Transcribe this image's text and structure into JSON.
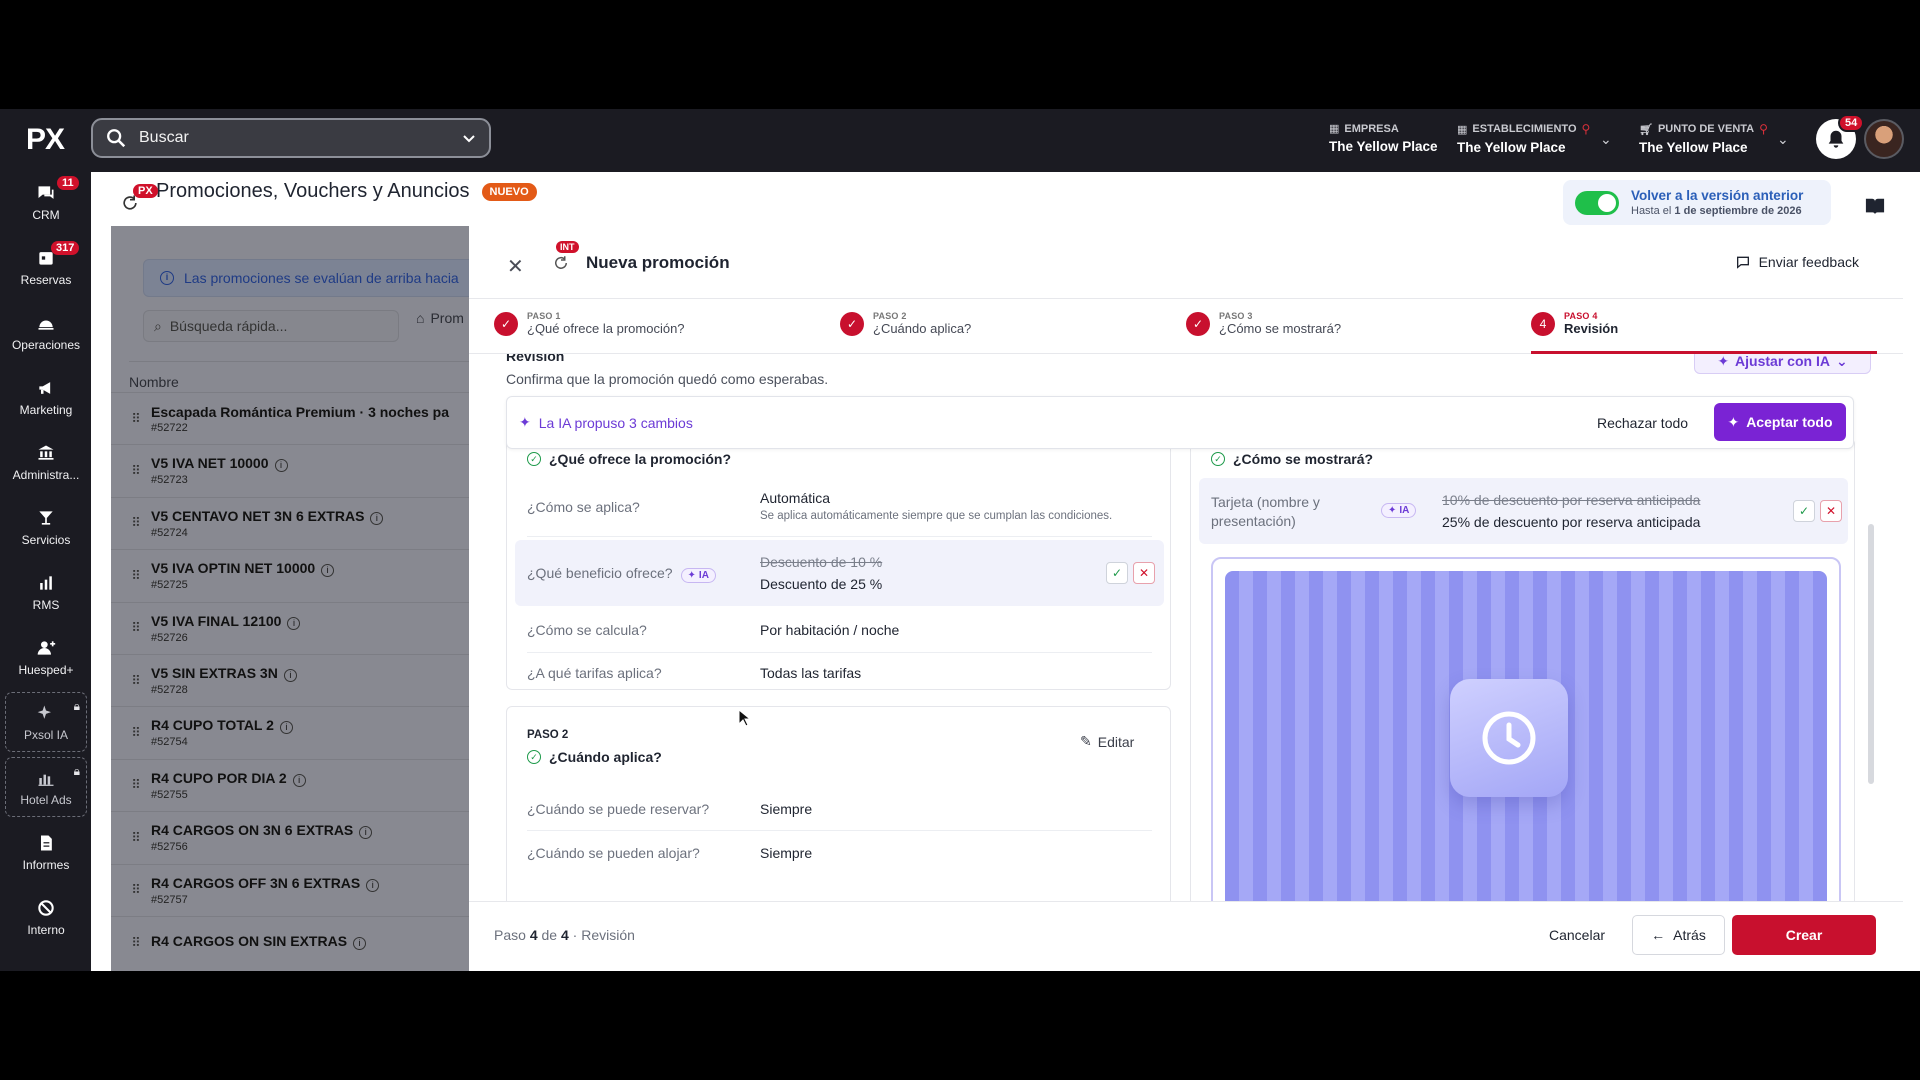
{
  "app": {
    "logo": "PX"
  },
  "search": {
    "placeholder": "Buscar"
  },
  "header": {
    "empresa": {
      "caption": "EMPRESA",
      "value": "The Yellow Place"
    },
    "establecimiento": {
      "caption": "ESTABLECIMIENTO",
      "value": "The Yellow Place"
    },
    "punto_venta": {
      "caption": "PUNTO DE VENTA",
      "value": "The Yellow Place"
    },
    "notifications": "54"
  },
  "sidebar": {
    "items": [
      {
        "label": "CRM",
        "badge": "11",
        "icon": "chat-icon"
      },
      {
        "label": "Reservas",
        "badge": "317",
        "icon": "calendar-icon"
      },
      {
        "label": "Operaciones",
        "icon": "bell-service-icon"
      },
      {
        "label": "Marketing",
        "icon": "megaphone-icon"
      },
      {
        "label": "Administra...",
        "icon": "bank-icon"
      },
      {
        "label": "Servicios",
        "icon": "cocktail-icon"
      },
      {
        "label": "RMS",
        "icon": "chart-icon"
      },
      {
        "label": "Huesped+",
        "icon": "guest-icon"
      },
      {
        "label": "Pxsol IA",
        "icon": "sparkle-icon",
        "locked": true
      },
      {
        "label": "Hotel Ads",
        "icon": "bar-chart-icon",
        "locked": true
      },
      {
        "label": "Informes",
        "icon": "document-icon"
      },
      {
        "label": "Interno",
        "icon": "block-icon"
      }
    ]
  },
  "page": {
    "title": "Promociones, Vouchers y Anuncios",
    "badge": "NUEVO",
    "px_badge": "PX",
    "toggle_title": "Volver a la versión anterior",
    "toggle_prefix": "Hasta el ",
    "toggle_date": "1 de septiembre de 2026"
  },
  "list": {
    "banner": "Las promociones se evalúan de arriba hacia",
    "quick_search": "Búsqueda rápida...",
    "filter": "Prom",
    "column": "Nombre",
    "rows": [
      {
        "name": "Escapada Romántica Premium · 3 noches pa",
        "id": "#52722"
      },
      {
        "name": "V5 IVA NET 10000",
        "id": "#52723"
      },
      {
        "name": "V5 CENTAVO NET 3N 6 EXTRAS",
        "id": "#52724"
      },
      {
        "name": "V5 IVA OPTIN NET 10000",
        "id": "#52725"
      },
      {
        "name": "V5 IVA FINAL 12100",
        "id": "#52726"
      },
      {
        "name": "V5 SIN EXTRAS 3N",
        "id": "#52728"
      },
      {
        "name": "R4 CUPO TOTAL 2",
        "id": "#52754"
      },
      {
        "name": "R4 CUPO POR DIA 2",
        "id": "#52755"
      },
      {
        "name": "R4 CARGOS ON 3N 6 EXTRAS",
        "id": "#52756"
      },
      {
        "name": "R4 CARGOS OFF 3N 6 EXTRAS",
        "id": "#52757"
      },
      {
        "name": "R4 CARGOS ON SIN EXTRAS",
        "id": ""
      }
    ]
  },
  "drawer": {
    "title": "Nueva promoción",
    "int_badge": "INT",
    "feedback": "Enviar feedback",
    "steps": [
      {
        "cap": "PASO 1",
        "label": "¿Qué ofrece la promoción?"
      },
      {
        "cap": "PASO 2",
        "label": "¿Cuándo aplica?"
      },
      {
        "cap": "PASO 3",
        "label": "¿Cómo se mostrará?"
      },
      {
        "cap": "PASO 4",
        "label": "Revisión",
        "number": "4"
      }
    ],
    "review_title": "Revisión",
    "review_sub": "Confirma que la promoción quedó como esperabas.",
    "adjust": "Ajustar con IA",
    "ai_proposal": "La IA propuso 3 cambios",
    "reject_all": "Rechazar todo",
    "accept_all": "Aceptar todo",
    "section1": {
      "title": "¿Qué ofrece la promoción?",
      "rows": [
        {
          "q": "¿Cómo se aplica?",
          "v": "Automática",
          "sub": "Se aplica automáticamente siempre que se cumplan las condiciones."
        },
        {
          "q": "¿Qué beneficio ofrece?",
          "chip": "IA",
          "old": "Descuento de 10 %",
          "v": "Descuento de 25 %"
        },
        {
          "q": "¿Cómo se calcula?",
          "v": "Por habitación / noche"
        },
        {
          "q": "¿A qué tarifas aplica?",
          "v": "Todas las tarifas"
        }
      ]
    },
    "section2": {
      "paso": "PASO 2",
      "title": "¿Cuándo aplica?",
      "edit": "Editar",
      "rows": [
        {
          "q": "¿Cuándo se puede reservar?",
          "v": "Siempre"
        },
        {
          "q": "¿Cuándo se pueden alojar?",
          "v": "Siempre"
        }
      ]
    },
    "section3": {
      "title": "¿Cómo se mostrará?",
      "q": "Tarjeta (nombre y presentación)",
      "chip": "IA",
      "old": "10% de descuento por reserva anticipada",
      "v": "25% de descuento por reserva anticipada"
    },
    "footer": {
      "paso": "Paso ",
      "current": "4",
      "de": " de ",
      "total": "4",
      "label": " · Revisión",
      "cancel": "Cancelar",
      "back": "Atrás",
      "create": "Crear"
    }
  },
  "colors": {
    "accent": "#c8102e",
    "ai": "#7a23d4",
    "topbar": "#1b1b22",
    "toggle": "#1fbf4a"
  }
}
